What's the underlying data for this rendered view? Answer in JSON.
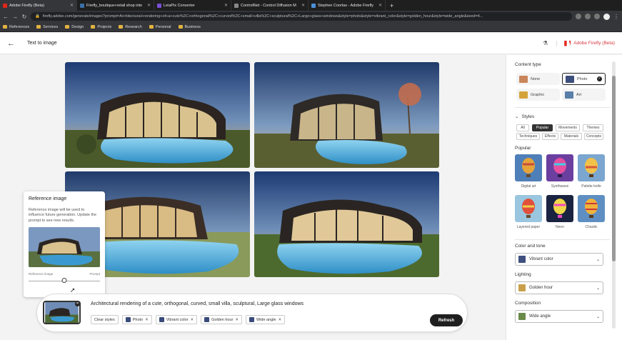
{
  "browser": {
    "tabs": [
      {
        "title": "Adobe Firefly (Beta)",
        "color": "#e1251b"
      },
      {
        "title": "Firefly_boutique+retail shop inte",
        "color": "#3a6ea5"
      },
      {
        "title": "LeiaPix Converter",
        "color": "#7b4fd6"
      },
      {
        "title": "ControlNet - Control Diffusion M",
        "color": "#888888"
      },
      {
        "title": "Stephen Coorlas - Adobe Firefly",
        "color": "#4a90d9"
      }
    ],
    "url": "firefly.adobe.com/generate/images?prompt=Architectural+rendering+of+a+cute%2C+orthogonal%2C+curved%2C+small+villa%2C+sculptural%2C+Large+glass+windows&style=photo&style=vibrant_color&style=golden_hour&style=wide_angle&seed=4...",
    "bookmarks": [
      "References",
      "Services",
      "Design",
      "Projects",
      "Research",
      "Personal",
      "Business"
    ]
  },
  "header": {
    "title": "Text to image",
    "brand": "Adobe Firefly (Beta)"
  },
  "reference_popup": {
    "title": "Reference image",
    "description": "Reference image will be used to influence future generation. Update the prompt to see new results.",
    "left_label": "Reference image",
    "right_label": "Prompt",
    "slider_value": 0.5
  },
  "prompt": {
    "text": "Architectural rendering of a cute, orthogonal, curved, small villa, sculptural, Large glass windows",
    "clear_label": "Clear styles",
    "chips": [
      "Photo",
      "Vibrant color",
      "Golden hour",
      "Wide angle"
    ],
    "refresh_label": "Refresh"
  },
  "panel": {
    "content_type": {
      "title": "Content type",
      "options": [
        "None",
        "Photo",
        "Graphic",
        "Art"
      ],
      "selected": "Photo"
    },
    "styles": {
      "title": "Styles",
      "tabs": [
        "All",
        "Popular",
        "Movements",
        "Themes",
        "Techniques",
        "Effects",
        "Materials",
        "Concepts"
      ],
      "selected_tab": "Popular",
      "section": "Popular",
      "cards": [
        "Digital art",
        "Synthwave",
        "Palette knife",
        "Layered paper",
        "Neon",
        "Chaotic"
      ]
    },
    "color_tone": {
      "title": "Color and tone",
      "value": "Vibrant color"
    },
    "lighting": {
      "title": "Lighting",
      "value": "Golden hour"
    },
    "composition": {
      "title": "Composition",
      "value": "Wide angle"
    }
  }
}
